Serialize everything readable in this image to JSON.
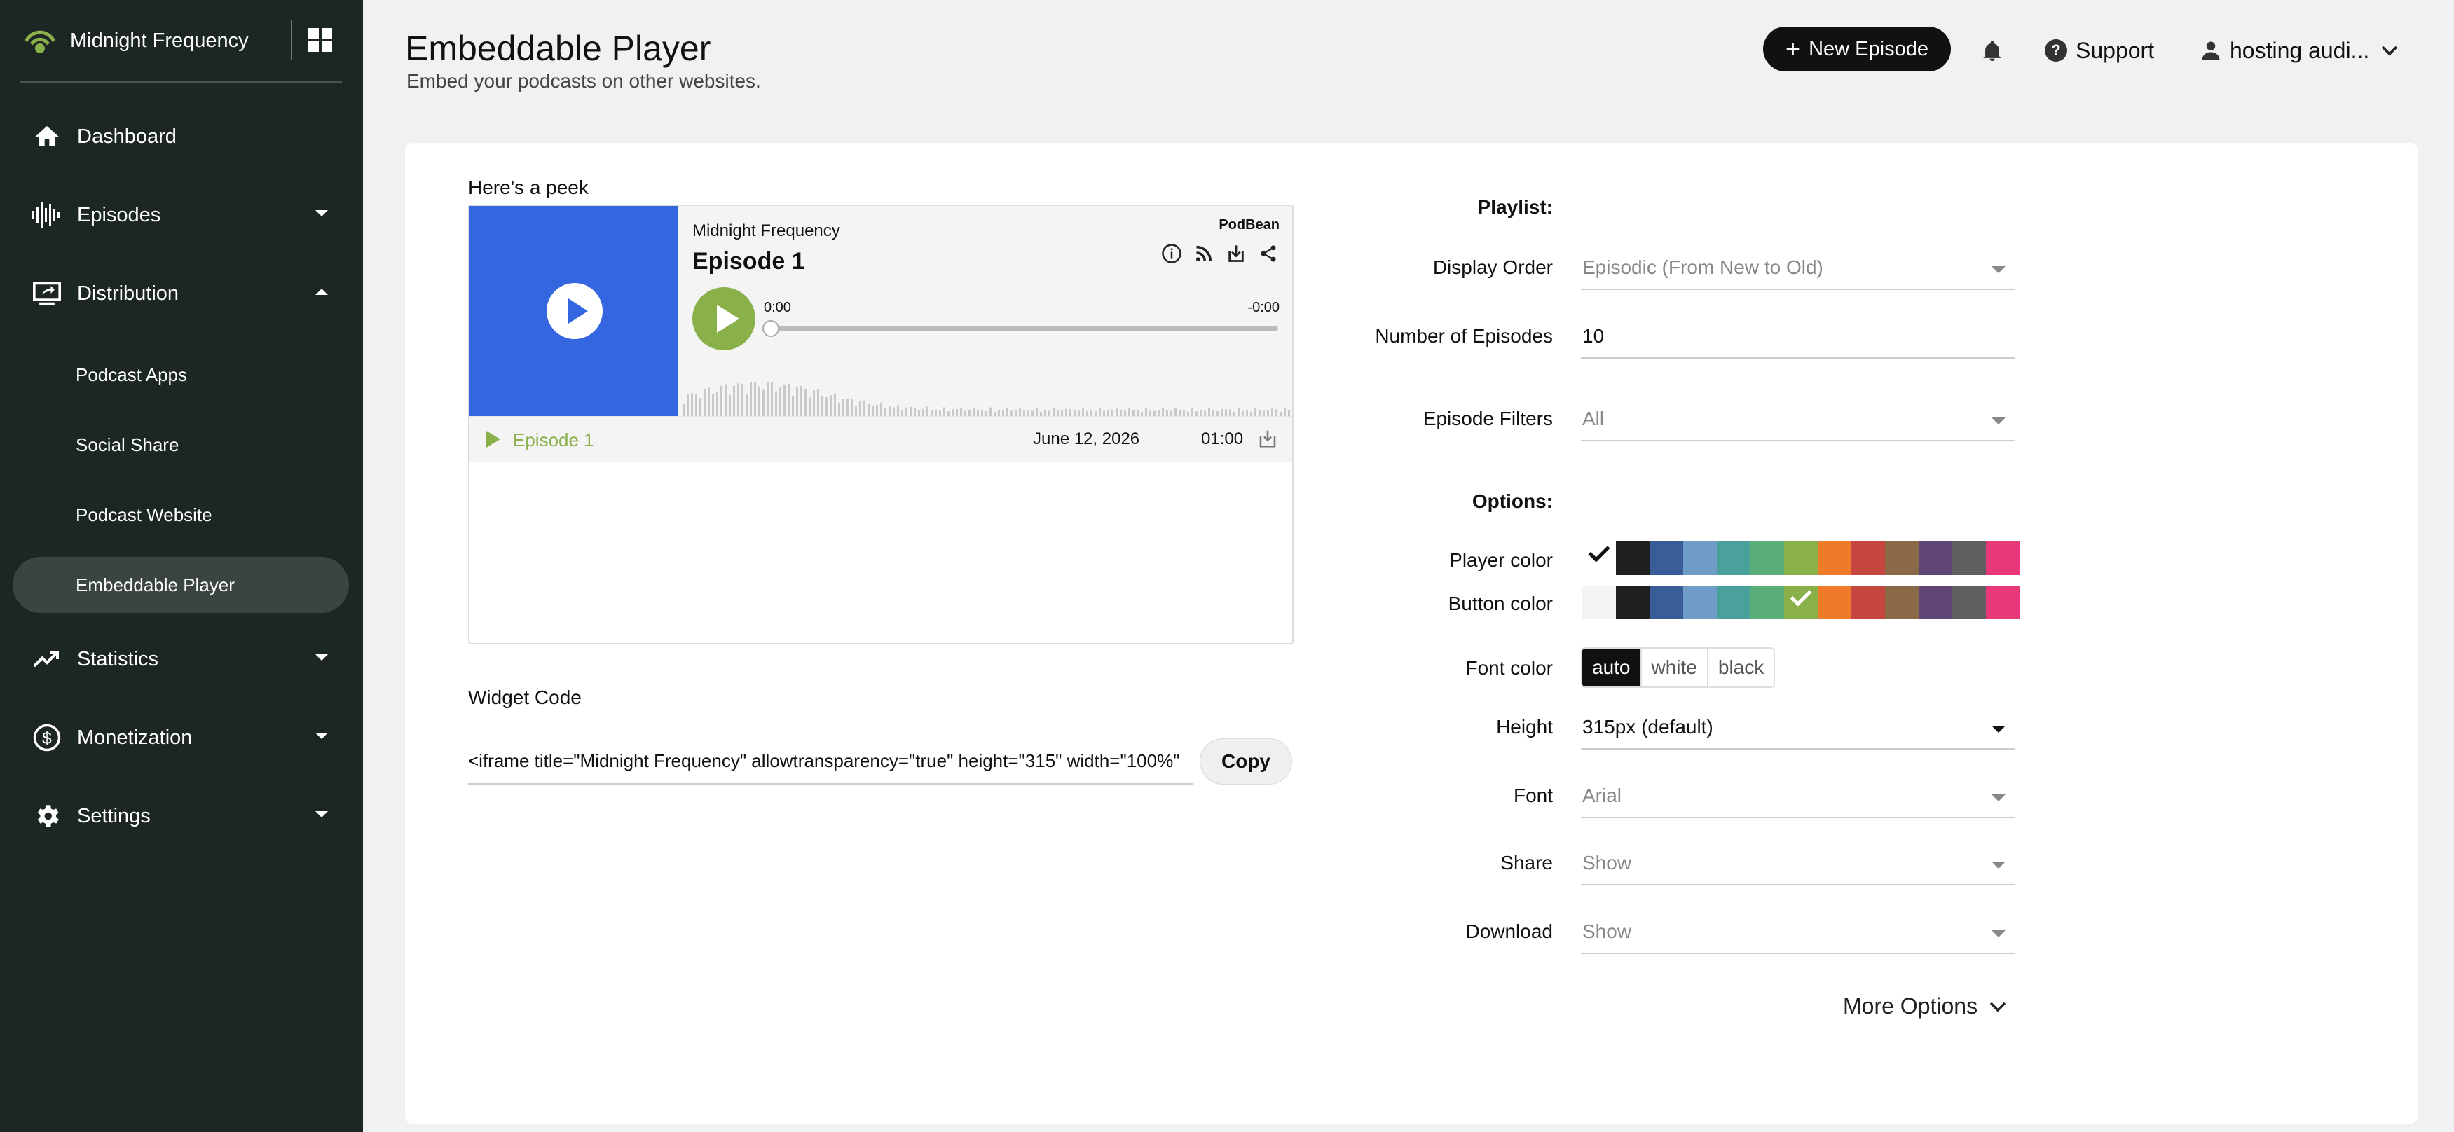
{
  "brand": {
    "name": "Midnight Frequency"
  },
  "sidebar": {
    "items": [
      {
        "label": "Dashboard",
        "icon": "home-icon"
      },
      {
        "label": "Episodes",
        "icon": "waveform-icon"
      },
      {
        "label": "Distribution",
        "icon": "monitor-share-icon"
      },
      {
        "label": "Statistics",
        "icon": "trend-up-icon"
      },
      {
        "label": "Monetization",
        "icon": "dollar-circle-icon"
      },
      {
        "label": "Settings",
        "icon": "gear-icon"
      }
    ],
    "sub_items": [
      {
        "label": "Podcast Apps"
      },
      {
        "label": "Social Share"
      },
      {
        "label": "Podcast Website"
      },
      {
        "label": "Embeddable Player",
        "active": true
      }
    ]
  },
  "header": {
    "title": "Embeddable Player",
    "subtitle": "Embed your podcasts on other websites.",
    "new_episode": "New Episode",
    "support": "Support",
    "user": "hosting audi..."
  },
  "preview": {
    "label": "Here's a peek",
    "show_name": "Midnight Frequency",
    "episode_title": "Episode 1",
    "brand_mark": "PodBean",
    "time_start": "0:00",
    "time_end": "-0:00",
    "playlist": [
      {
        "title": "Episode 1",
        "date": "June 12, 2026",
        "duration": "01:00"
      }
    ]
  },
  "widget": {
    "label": "Widget Code",
    "code": "<iframe title=\"Midnight Frequency\" allowtransparency=\"true\" height=\"315\" width=\"100%\"",
    "copy": "Copy"
  },
  "form": {
    "playlist_label": "Playlist:",
    "display_order_label": "Display Order",
    "display_order_value": "Episodic (From New to Old)",
    "num_episodes_label": "Number of Episodes",
    "num_episodes_value": "10",
    "episode_filters_label": "Episode Filters",
    "episode_filters_value": "All",
    "options_label": "Options:",
    "player_color_label": "Player color",
    "button_color_label": "Button color",
    "font_color_label": "Font color",
    "font_color_options": [
      "auto",
      "white",
      "black"
    ],
    "font_color_selected": "auto",
    "height_label": "Height",
    "height_value": "315px (default)",
    "font_label": "Font",
    "font_value": "Arial",
    "share_label": "Share",
    "share_value": "Show",
    "download_label": "Download",
    "download_value": "Show",
    "more_options": "More Options"
  },
  "colors": {
    "accent": "#8ab04a",
    "cover": "#3466e0",
    "sidebar_bg": "#1c2624",
    "player_palette": [
      "#ffffff",
      "#1f1f1f",
      "#3a5d9a",
      "#6f9dc8",
      "#4aa19b",
      "#5aae7a",
      "#8ab04a",
      "#ef7a2a",
      "#c4463f",
      "#8a6a48",
      "#5f4676",
      "#5f5f5f",
      "#e8387a"
    ],
    "button_palette": [
      "#f3f3f3",
      "#1f1f1f",
      "#3a5d9a",
      "#6f9dc8",
      "#4aa19b",
      "#5aae7a",
      "#8ab04a",
      "#ef7a2a",
      "#c4463f",
      "#8a6a48",
      "#5f4676",
      "#5f5f5f",
      "#e8387a"
    ],
    "player_selected_index": 0,
    "button_selected_index": 6
  }
}
